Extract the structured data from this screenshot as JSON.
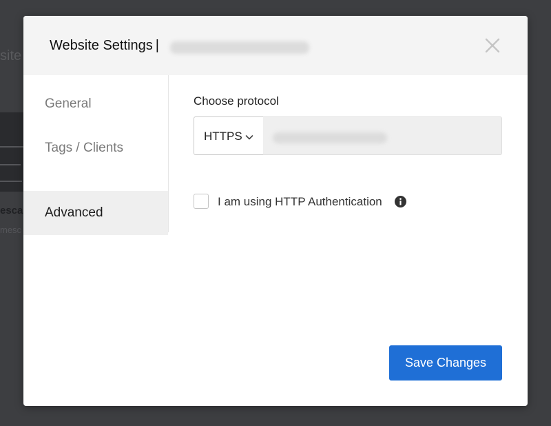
{
  "background": {
    "partial_text_top": "site",
    "partial_text_mid": "escap",
    "partial_text_low": "mesc"
  },
  "modal": {
    "title": "Website Settings",
    "title_separator": "|",
    "close_icon": "close-icon"
  },
  "sidebar": {
    "items": [
      {
        "label": "General",
        "active": false
      },
      {
        "label": "Tags / Clients",
        "active": false
      },
      {
        "label": "Advanced",
        "active": true
      }
    ]
  },
  "content": {
    "protocol_label": "Choose protocol",
    "protocol_value": "HTTPS",
    "auth_checkbox_label": "I am using HTTP Authentication",
    "auth_checked": false,
    "info_icon": "info-icon"
  },
  "actions": {
    "save_label": "Save Changes"
  },
  "colors": {
    "primary": "#1f6fd6",
    "header_bg": "#f4f4f4",
    "active_item_bg": "#efefef"
  }
}
